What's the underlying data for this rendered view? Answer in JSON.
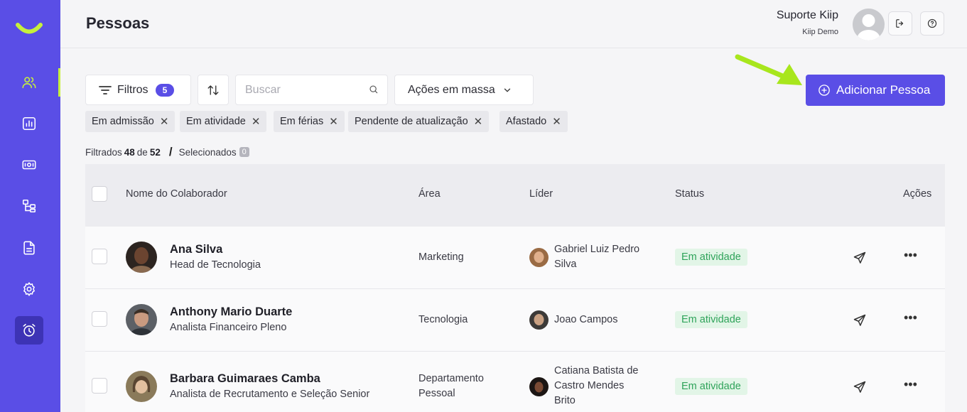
{
  "header": {
    "title": "Pessoas",
    "user_name": "Suporte Kiip",
    "user_company": "Kiip Demo"
  },
  "toolbar": {
    "filters_label": "Filtros",
    "filters_count": "5",
    "search_placeholder": "Buscar",
    "mass_actions_label": "Ações em massa",
    "add_person_label": "Adicionar Pessoa"
  },
  "chips": [
    "Em admissão",
    "Em atividade",
    "Em férias",
    "Pendente de atualização",
    "Afastado"
  ],
  "counts": {
    "filtered_label": "Filtrados",
    "filtered": "48",
    "of_label": "de",
    "total": "52",
    "selected_label": "Selecionados",
    "selected": "0"
  },
  "table": {
    "columns": [
      "Nome do Colaborador",
      "Área",
      "Líder",
      "Status",
      "Ações"
    ],
    "rows": [
      {
        "name": "Ana Silva",
        "role": "Head de Tecnologia",
        "area": "Marketing",
        "leader_lines": [
          "Gabriel Luiz Pedro",
          "Silva"
        ],
        "status": "Em atividade"
      },
      {
        "name": "Anthony Mario Duarte",
        "role": "Analista Financeiro Pleno",
        "area": "Tecnologia",
        "leader_lines": [
          "Joao Campos"
        ],
        "status": "Em atividade"
      },
      {
        "name": "Barbara Guimaraes Camba",
        "role": "Analista de Recrutamento e Seleção Senior",
        "area_lines": [
          "Departamento",
          "Pessoal"
        ],
        "leader_lines": [
          "Catiana Batista de",
          "Castro Mendes",
          "Brito"
        ],
        "status": "Em atividade"
      }
    ]
  },
  "colors": {
    "brand": "#5a4ee6",
    "accent": "#c6f03c",
    "status_active_bg": "#e2f5e7",
    "status_active_text": "#2fa35a"
  },
  "icons": {
    "sidebar": [
      "people-icon",
      "chart-icon",
      "payment-icon",
      "org-chart-icon",
      "document-icon",
      "settings-icon",
      "alarm-clock-icon"
    ],
    "header": [
      "logout-icon",
      "help-icon"
    ]
  }
}
